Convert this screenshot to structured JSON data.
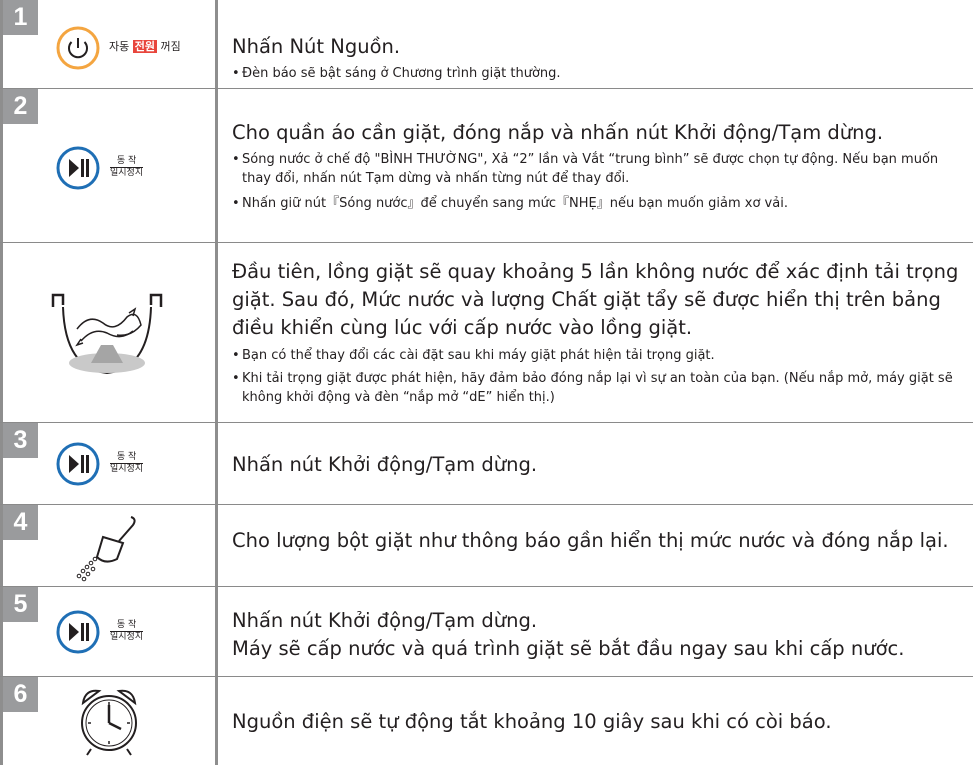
{
  "steps": [
    {
      "number": "1",
      "panel_icon": "power-button-icon",
      "panel_text": {
        "before": "자동",
        "highlight": "전원",
        "after": "꺼짐"
      },
      "main": "Nhấn Nút Nguồn.",
      "bullets": [
        "Đèn báo sẽ bật sáng ở Chương trình giặt thường."
      ]
    },
    {
      "number": "2",
      "panel_icon": "play-pause-button-icon",
      "panel_text": {
        "top": "동 작",
        "bottom": "일시정지"
      },
      "main": "Cho quần áo cần giặt, đóng nắp và nhấn nút Khởi động/Tạm dừng.",
      "bullets": [
        "Sóng nước ở chế độ \"BÌNH THƯỜNG\", Xả “2” lần và Vắt “trung bình” sẽ được chọn tự động. Nếu bạn muốn thay đổi, nhấn nút Tạm dừng và nhấn từng nút để thay đổi.",
        "Nhấn giữ nút『Sóng nước』để chuyển sang mức『NHẸ』nếu bạn muốn giảm xơ vải."
      ]
    },
    {
      "number": "",
      "panel_icon": "washer-tub-icon",
      "main": "Đầu tiên, lồng giặt sẽ quay khoảng 5 lần không nước để xác định tải trọng giặt. Sau đó, Mức nước và lượng Chất giặt tẩy sẽ được hiển thị trên bảng điều khiển cùng lúc với cấp nước vào lồng giặt.",
      "bullets": [
        "Bạn có thể thay đổi các cài đặt sau khi máy giặt phát hiện tải trọng giặt.",
        "Khi tải trọng giặt được phát hiện, hãy đảm bảo đóng nắp lại vì sự an toàn của bạn. (Nếu nắp mở, máy giặt sẽ không khởi động và đèn “nắp mở “dE” hiển thị.)"
      ]
    },
    {
      "number": "3",
      "panel_icon": "play-pause-button-icon",
      "panel_text": {
        "top": "동 작",
        "bottom": "일시정지"
      },
      "main": "Nhấn nút Khởi động/Tạm dừng.",
      "bullets": []
    },
    {
      "number": "4",
      "panel_icon": "detergent-scoop-icon",
      "main": "Cho lượng bột giặt như thông báo gần hiển thị mức nước và đóng nắp lại.",
      "bullets": []
    },
    {
      "number": "5",
      "panel_icon": "play-pause-button-icon",
      "panel_text": {
        "top": "동 작",
        "bottom": "일시정지"
      },
      "main": "Nhấn nút Khởi động/Tạm dừng.",
      "main2": "Máy sẽ cấp nước và quá trình giặt sẽ bắt đầu ngay sau khi cấp nước.",
      "bullets": []
    },
    {
      "number": "6",
      "panel_icon": "alarm-clock-icon",
      "main": "Nguồn điện sẽ tự động tắt khoảng 10 giây sau khi có còi báo.",
      "bullets": []
    }
  ],
  "bullet_mark": "•",
  "colors": {
    "step_badge": "#9a9b9d",
    "border": "#8e8e8e",
    "power_ring": "#f4a540",
    "play_ring": "#1f6fb5",
    "korean_highlight": "#e8453c",
    "text": "#231f20"
  }
}
